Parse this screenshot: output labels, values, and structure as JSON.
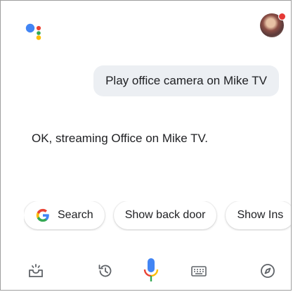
{
  "conversation": {
    "user_query": "Play office camera on Mike TV",
    "assistant_reply": "OK, streaming Office on Mike TV."
  },
  "suggestion_chips": [
    {
      "label": "Search",
      "icon": "google-g-icon"
    },
    {
      "label": "Show back door"
    },
    {
      "label": "Show Ins"
    }
  ],
  "bottom_bar": {
    "icons": [
      "snapshot-icon",
      "history-icon",
      "microphone-icon",
      "keyboard-icon",
      "explore-compass-icon"
    ]
  },
  "colors": {
    "google_blue": "#4285F4",
    "google_red": "#EA4335",
    "google_yellow": "#FBBC05",
    "google_green": "#34A853",
    "bubble_bg": "#eceff3",
    "icon_gray": "#5f6368"
  }
}
